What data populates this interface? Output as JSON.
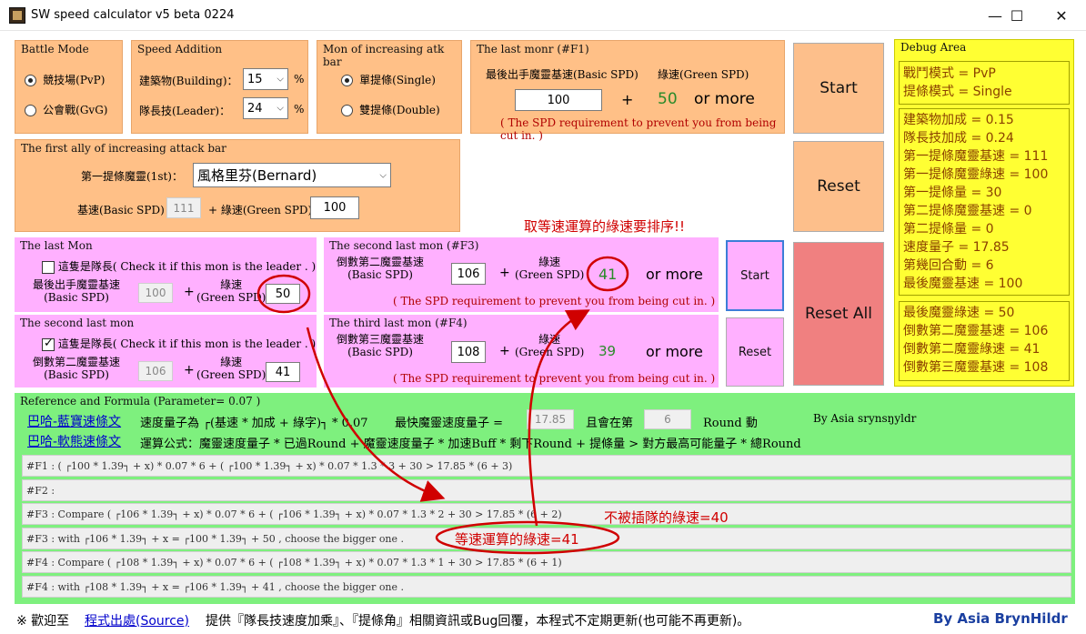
{
  "window": {
    "title": "SW speed calculator v5 beta 0224",
    "minimize": "—",
    "maximize": "☐",
    "close": "✕"
  },
  "battle_mode": {
    "title": "Battle Mode",
    "options": [
      "競技場(PvP)",
      "公會戰(GvG)"
    ],
    "selected": "競技場(PvP)"
  },
  "speed_addition": {
    "title": "Speed Addition",
    "building_label": "建築物(Building)：",
    "building_value": "15",
    "leader_label": "隊長技(Leader)：",
    "leader_value": "24",
    "unit": "%"
  },
  "atk_bar": {
    "title": "Mon of increasing atk bar",
    "options": [
      "單提條(Single)",
      "雙提條(Double)"
    ],
    "selected": "單提條(Single)"
  },
  "last_monr": {
    "title": "The last monr (#F1)",
    "basic_label": "最後出手魔靈基速(Basic SPD)",
    "green_label": "綠速(Green SPD)",
    "basic_value": "100",
    "plus": "+",
    "green_value": "50",
    "or_more": "or more",
    "note": "( The SPD requirement to prevent you from being cut in. )"
  },
  "first_ally": {
    "title": "The first ally of increasing attack bar",
    "first_label": "第一提條魔靈(1st)：",
    "first_value": "風格里芬(Bernard)",
    "basic_label": "基速(Basic SPD)",
    "basic_value": "111",
    "green_label": "+ 綠速(Green SPD)",
    "green_value": "100"
  },
  "buttons": {
    "start": "Start",
    "reset": "Reset",
    "reset_all": "Reset All",
    "start_small": "Start",
    "reset_small": "Reset"
  },
  "debug": {
    "title": "Debug Area",
    "block1": [
      "戰鬥模式 = PvP",
      "提條模式 = Single"
    ],
    "block2": [
      "建築物加成 = 0.15",
      "隊長技加成 = 0.24",
      "第一提條魔靈基速 = 111",
      "第一提條魔靈綠速 = 100",
      "第一提條量 = 30",
      "第二提條魔靈基速 = 0",
      "第二提條量 = 0",
      "速度量子 = 17.85",
      "第幾回合動 = 6",
      "最後魔靈基速 = 100"
    ],
    "block3": [
      "最後魔靈綠速 = 50",
      "倒數第二魔靈基速 = 106",
      "倒數第二魔靈綠速 = 41",
      "倒數第三魔靈基速 = 108"
    ]
  },
  "sort_note": "取等速運算的綠速要排序!!",
  "last_mon": {
    "title": "The last Mon",
    "check_label": "這隻是隊長( Check it if this mon is the leader . )",
    "checked": false,
    "basic_label1": "最後出手魔靈基速",
    "basic_label2": "(Basic SPD)",
    "basic_value": "100",
    "plus": "+",
    "green_label1": "綠速",
    "green_label2": "(Green SPD)",
    "green_value": "50"
  },
  "second_last_mon": {
    "title": "The second last mon",
    "check_label": "這隻是隊長( Check it if this mon is the leader . )",
    "checked": true,
    "basic_label1": "倒數第二魔靈基速",
    "basic_label2": "(Basic SPD)",
    "basic_value": "106",
    "plus": "+",
    "green_label1": "綠速",
    "green_label2": "(Green SPD)",
    "green_value": "41"
  },
  "f3": {
    "title": "The second last mon (#F3)",
    "basic_label1": "倒數第二魔靈基速",
    "basic_label2": "(Basic SPD)",
    "basic_value": "106",
    "plus": "+",
    "green_label1": "綠速",
    "green_label2": "(Green SPD)",
    "green_value": "41",
    "or_more": "or more",
    "note": "( The SPD requirement to prevent you from being cut in. )"
  },
  "f4": {
    "title": "The third last mon (#F4)",
    "basic_label1": "倒數第三魔靈基速",
    "basic_label2": "(Basic SPD)",
    "basic_value": "108",
    "plus": "+",
    "green_label1": "綠速",
    "green_label2": "(Green SPD)",
    "green_value": "39",
    "or_more": "or more",
    "note": "( The SPD requirement to prevent you from being cut in. )"
  },
  "reference": {
    "title": "Reference and Formula (Parameter= 0.07 )",
    "link1": "巴哈-藍寶速條文",
    "link2": "巴哈-軟熊速條文",
    "quantum_text": "速度量子為 ┌(基速 * 加成 + 綠字)┐ * 0.07",
    "fastest_label": "最快魔靈速度量子 =",
    "fastest_value": "17.85",
    "round_label1": "且會在第",
    "round_value": "6",
    "round_label2": "Round 動",
    "by_text": "By Asia srynsŋyldr",
    "formula_text": "運算公式：魔靈速度量子 * 已過Round + 魔靈速度量子 * 加速Buff * 剩下Round + 提條量 > 對方最高可能量子 * 總Round",
    "rows": [
      "#F1 : ( ┌100 * 1.39┐ + x) * 0.07 * 6 + ( ┌100 * 1.39┐ + x) * 0.07 * 1.3 * 3 + 30 > 17.85 * (6 + 3)",
      "#F2 :",
      "#F3 : Compare   ( ┌106 * 1.39┐ + x) * 0.07 * 6 + ( ┌106 * 1.39┐ + x) * 0.07 * 1.3 * 2 + 30 > 17.85 * (6 + 2)",
      "#F3 :        with    ┌106 * 1.39┐ + x =  ┌100 * 1.39┐ + 50  , choose the bigger one .",
      "#F4 : Compare   ( ┌108 * 1.39┐ + x) * 0.07 * 6 + ( ┌108 * 1.39┐ + x) * 0.07 * 1.3 * 1 + 30 > 17.85 * (6 + 1)",
      "#F4 :        with    ┌108 * 1.39┐ + x =  ┌106 * 1.39┐ + 41  , choose the bigger one ."
    ]
  },
  "annotations": {
    "not_cut": "不被插隊的綠速=40",
    "equal_speed": "等速運算的綠速=41"
  },
  "footer": {
    "prefix": "※ 歡迎至",
    "link": "程式出處(Source)",
    "text": "提供『隊長技速度加乘』、『提條角』相關資訊或Bug回覆，本程式不定期更新(也可能不再更新)。",
    "signature": "By Asia BrynHildr"
  },
  "colors": {
    "orange_panel": "#ffc087",
    "pink_panel": "#ffb0ff",
    "green_panel": "#7ef07e",
    "yellow_panel": "#ffff33",
    "reset_all": "#f08080",
    "annotation_red": "#d00000"
  }
}
